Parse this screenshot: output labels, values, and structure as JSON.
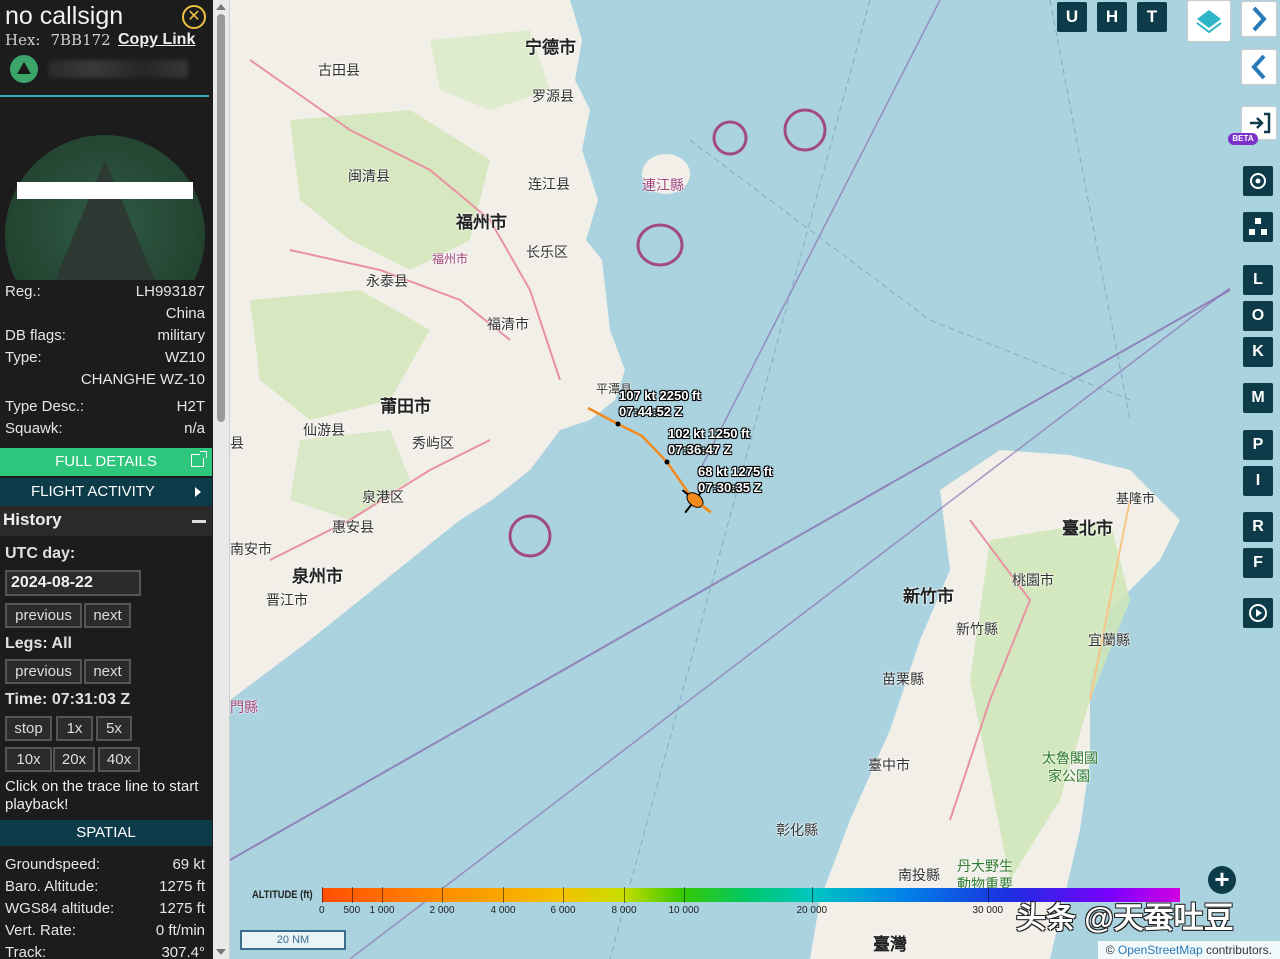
{
  "aircraft": {
    "callsign": "no callsign",
    "hex_label": "Hex:",
    "hex": "7BB172",
    "copy_link": "Copy Link"
  },
  "details": {
    "reg_label": "Reg.:",
    "reg": "LH993187",
    "country": "China",
    "db_flags_label": "DB flags:",
    "db_flags": "military",
    "type_label": "Type:",
    "type": "WZ10",
    "type_full": "CHANGHE WZ-10",
    "type_desc_label": "Type Desc.:",
    "type_desc": "H2T",
    "squawk_label": "Squawk:",
    "squawk": "n/a"
  },
  "buttons": {
    "full_details": "FULL DETAILS",
    "flight_activity": "FLIGHT ACTIVITY"
  },
  "history": {
    "title": "History",
    "utc_day_label": "UTC day:",
    "utc_day": "2024-08-22",
    "previous": "previous",
    "next": "next",
    "legs_label": "Legs: All",
    "time_label": "Time: 07:31:03 Z",
    "stop": "stop",
    "x1": "1x",
    "x5": "5x",
    "x10": "10x",
    "x20": "20x",
    "x40": "40x",
    "note": "Click on the trace line to start playback!"
  },
  "spatial": {
    "title": "SPATIAL",
    "groundspeed_label": "Groundspeed:",
    "groundspeed": "69 kt",
    "baro_label": "Baro. Altitude:",
    "baro": "1275 ft",
    "wgs_label": "WGS84 altitude:",
    "wgs": "1275 ft",
    "vert_label": "Vert. Rate:",
    "vert": "0 ft/min",
    "track_label": "Track:",
    "track": "307.4°"
  },
  "map": {
    "labels": {
      "ningde": "宁德市",
      "gutian": "古田县",
      "luoyuan": "罗源县",
      "minqing": "闽清县",
      "lianjiang": "连江县",
      "lianjiang_tw": "連江縣",
      "fuzhou": "福州市",
      "fuzhou2": "福州市",
      "changle": "长乐区",
      "yongtai": "永泰县",
      "fuqing": "福清市",
      "pingtan": "平潭县",
      "putian": "莆田市",
      "xianyou": "仙游县",
      "xiuyu": "秀屿区",
      "quangang": "泉港区",
      "huian": "惠安县",
      "nanan": "南安市",
      "quanzhou": "泉州市",
      "jinjiang": "晋江市",
      "jinmen": "門縣",
      "jiaxian": "县",
      "keelung": "基隆市",
      "taipei": "臺北市",
      "taoyuan": "桃園市",
      "hsinchu_city": "新竹市",
      "hsinchu_county": "新竹縣",
      "yilan": "宜蘭縣",
      "miaoli": "苗栗縣",
      "taichung": "臺中市",
      "changhua": "彰化縣",
      "nantou": "南投縣",
      "taroko": "太魯閣國",
      "taroko2": "家公園",
      "danda": "丹大野生",
      "danda2": "動物重要",
      "taiwan": "臺灣"
    },
    "track_labels": [
      {
        "speed": "107 kt",
        "alt": "2250 ft",
        "time": "07:44:52 Z"
      },
      {
        "speed": "102 kt",
        "alt": "1250 ft",
        "time": "07:36:47 Z"
      },
      {
        "speed": "68 kt",
        "alt": "1275 ft",
        "time": "07:30:35 Z"
      }
    ],
    "top_buttons": [
      "U",
      "H",
      "T"
    ],
    "side_buttons": [
      "L",
      "O",
      "K",
      "M",
      "P",
      "I",
      "R",
      "F"
    ],
    "beta": "BETA",
    "altitude_title": "ALTITUDE (ft)",
    "altitude_ticks": [
      "0",
      "500",
      "1 000",
      "2 000",
      "4 000",
      "6 000",
      "8 000",
      "10 000",
      "20 000",
      "30 000"
    ],
    "scale": "20 NM",
    "attribution_prefix": "©",
    "attribution_link": "OpenStreetMap",
    "attribution_suffix": " contributors.",
    "watermark": "头条 @天蚕吐豆",
    "colors": {
      "track": "#f28a1e",
      "panel": "#0e3b4a",
      "green": "#2ec57d",
      "sea": "#aad3df",
      "land": "#f2efe9"
    }
  }
}
